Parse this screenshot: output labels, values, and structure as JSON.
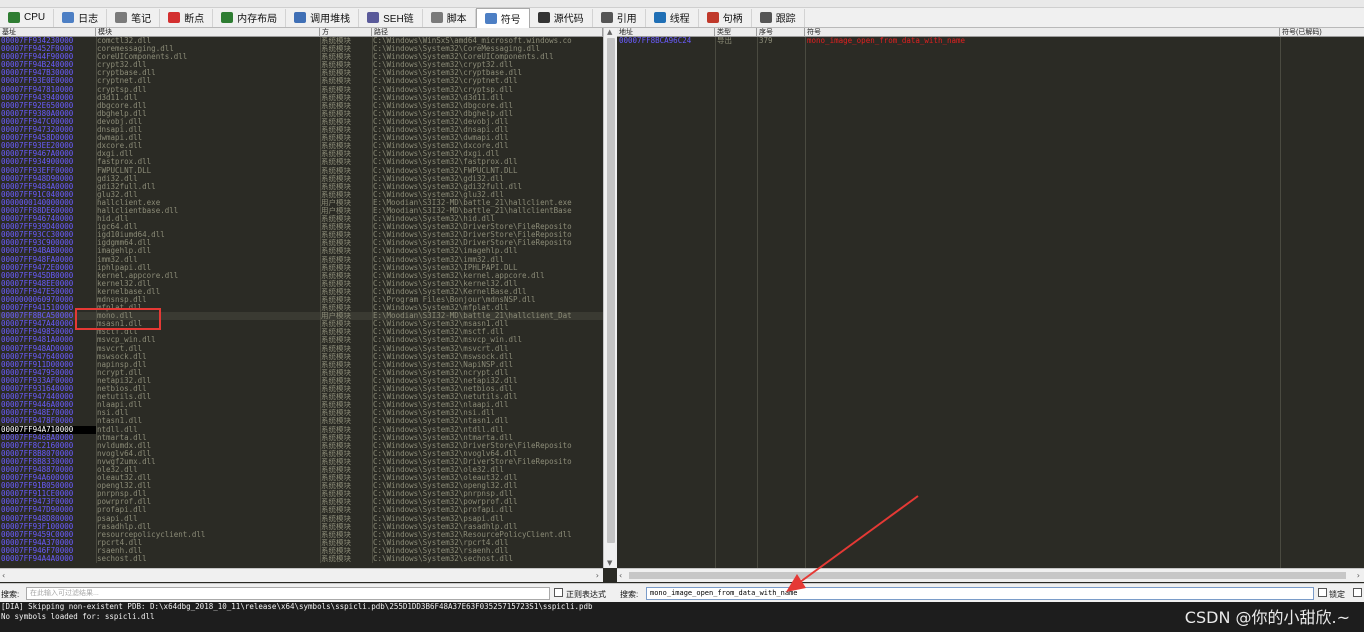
{
  "tabs": [
    {
      "label": "CPU",
      "icon": "cpu-icon",
      "color": "#2f7d32"
    },
    {
      "label": "日志",
      "icon": "log-icon",
      "color": "#4d7fc4"
    },
    {
      "label": "笔记",
      "icon": "notes-icon",
      "color": "#7a7a7a"
    },
    {
      "label": "断点",
      "icon": "breakpoint-icon",
      "color": "#d32f2f"
    },
    {
      "label": "内存布局",
      "icon": "memory-map-icon",
      "color": "#2e7d32"
    },
    {
      "label": "调用堆栈",
      "icon": "call-stack-icon",
      "color": "#3f6fb5"
    },
    {
      "label": "SEH链",
      "icon": "seh-chain-icon",
      "color": "#5a5a9a"
    },
    {
      "label": "脚本",
      "icon": "script-icon",
      "color": "#7a7a7a"
    },
    {
      "label": "符号",
      "icon": "symbols-icon",
      "color": "#4d7fc4"
    },
    {
      "label": "源代码",
      "icon": "source-icon",
      "color": "#333333"
    },
    {
      "label": "引用",
      "icon": "references-icon",
      "color": "#555555"
    },
    {
      "label": "线程",
      "icon": "threads-icon",
      "color": "#1f6fb5"
    },
    {
      "label": "句柄",
      "icon": "handles-icon",
      "color": "#c0392b"
    },
    {
      "label": "跟踪",
      "icon": "trace-icon",
      "color": "#555555"
    }
  ],
  "active_tab": 8,
  "left": {
    "headers": [
      "基址",
      "模块",
      "方",
      "路径"
    ],
    "rows": [
      [
        "00007FF934230000",
        "comctl32.dll",
        "系统模块",
        "C:\\Windows\\WinSxS\\amd64_microsoft.windows.co"
      ],
      [
        "00007FF9452F0000",
        "coremessaging.dll",
        "系统模块",
        "C:\\Windows\\System32\\CoreMessaging.dll"
      ],
      [
        "00007FF944F90000",
        "CoreUIComponents.dll",
        "系统模块",
        "C:\\Windows\\System32\\CoreUIComponents.dll"
      ],
      [
        "00007FF94B240000",
        "crypt32.dll",
        "系统模块",
        "C:\\Windows\\System32\\crypt32.dll"
      ],
      [
        "00007FF947B30000",
        "cryptbase.dll",
        "系统模块",
        "C:\\Windows\\System32\\cryptbase.dll"
      ],
      [
        "00007FF93E0E0000",
        "cryptnet.dll",
        "系统模块",
        "C:\\Windows\\System32\\cryptnet.dll"
      ],
      [
        "00007FF947810000",
        "cryptsp.dll",
        "系统模块",
        "C:\\Windows\\System32\\cryptsp.dll"
      ],
      [
        "00007FF943940000",
        "d3d11.dll",
        "系统模块",
        "C:\\Windows\\System32\\d3d11.dll"
      ],
      [
        "00007FF92E650000",
        "dbgcore.dll",
        "系统模块",
        "C:\\Windows\\System32\\dbgcore.dll"
      ],
      [
        "00007FF9380A0000",
        "dbghelp.dll",
        "系统模块",
        "C:\\Windows\\System32\\dbghelp.dll"
      ],
      [
        "00007FF947C00000",
        "devobj.dll",
        "系统模块",
        "C:\\Windows\\System32\\devobj.dll"
      ],
      [
        "00007FF947320000",
        "dnsapi.dll",
        "系统模块",
        "C:\\Windows\\System32\\dnsapi.dll"
      ],
      [
        "00007FF9458D0000",
        "dwmapi.dll",
        "系统模块",
        "C:\\Windows\\System32\\dwmapi.dll"
      ],
      [
        "00007FF93EE20000",
        "dxcore.dll",
        "系统模块",
        "C:\\Windows\\System32\\dxcore.dll"
      ],
      [
        "00007FF9467A0000",
        "dxgi.dll",
        "系统模块",
        "C:\\Windows\\System32\\dxgi.dll"
      ],
      [
        "00007FF934900000",
        "fastprox.dll",
        "系统模块",
        "C:\\Windows\\System32\\fastprox.dll"
      ],
      [
        "00007FF93EFF0000",
        "FWPUCLNT.DLL",
        "系统模块",
        "C:\\Windows\\System32\\FWPUCLNT.DLL"
      ],
      [
        "00007FF948D90000",
        "gdi32.dll",
        "系统模块",
        "C:\\Windows\\System32\\gdi32.dll"
      ],
      [
        "00007FF9484A0000",
        "gdi32full.dll",
        "系统模块",
        "C:\\Windows\\System32\\gdi32full.dll"
      ],
      [
        "00007FF91C040000",
        "glu32.dll",
        "系统模块",
        "C:\\Windows\\System32\\glu32.dll"
      ],
      [
        "0000000140000000",
        "hallclient.exe",
        "用户模块",
        "E:\\Moodian\\S3I32-MD\\battle_21\\hallclient.exe"
      ],
      [
        "00007FF88DE60000",
        "hallclientbase.dll",
        "用户模块",
        "E:\\Moodian\\S3I32-MD\\battle_21\\hallclientBase"
      ],
      [
        "00007FF946740000",
        "hid.dll",
        "系统模块",
        "C:\\Windows\\System32\\hid.dll"
      ],
      [
        "00007FF939D40000",
        "igc64.dll",
        "系统模块",
        "C:\\Windows\\System32\\DriverStore\\FileReposito"
      ],
      [
        "00007FF93CC30000",
        "igd10iumd64.dll",
        "系统模块",
        "C:\\Windows\\System32\\DriverStore\\FileReposito"
      ],
      [
        "00007FF93C900000",
        "igdgmm64.dll",
        "系统模块",
        "C:\\Windows\\System32\\DriverStore\\FileReposito"
      ],
      [
        "00007FF94BAB0000",
        "imagehlp.dll",
        "系统模块",
        "C:\\Windows\\System32\\imagehlp.dll"
      ],
      [
        "00007FF948FA0000",
        "imm32.dll",
        "系统模块",
        "C:\\Windows\\System32\\imm32.dll"
      ],
      [
        "00007FF9472E0000",
        "iphlpapi.dll",
        "系统模块",
        "C:\\Windows\\System32\\IPHLPAPI.DLL"
      ],
      [
        "00007FF945DB0000",
        "kernel.appcore.dll",
        "系统模块",
        "C:\\Windows\\System32\\kernel.appcore.dll"
      ],
      [
        "00007FF948EE0000",
        "kernel32.dll",
        "系统模块",
        "C:\\Windows\\System32\\kernel32.dll"
      ],
      [
        "00007FF947E50000",
        "kernelbase.dll",
        "系统模块",
        "C:\\Windows\\System32\\KernelBase.dll"
      ],
      [
        "0000000060970000",
        "mdnsnsp.dll",
        "系统模块",
        "C:\\Program Files\\Bonjour\\mdnsNSP.dll"
      ],
      [
        "00007FF941510000",
        "mfplat.dll",
        "系统模块",
        "C:\\Windows\\System32\\mfplat.dll"
      ],
      [
        "00007FF8BCA50000",
        "mono.dll",
        "用户模块",
        "E:\\Moodian\\S3I32-MD\\battle_21\\hallclient_Dat"
      ],
      [
        "00007FF947A40000",
        "msasn1.dll",
        "系统模块",
        "C:\\Windows\\System32\\msasn1.dll"
      ],
      [
        "00007FF949850000",
        "msctf.dll",
        "系统模块",
        "C:\\Windows\\System32\\msctf.dll"
      ],
      [
        "00007FF9481A0000",
        "msvcp_win.dll",
        "系统模块",
        "C:\\Windows\\System32\\msvcp_win.dll"
      ],
      [
        "00007FF948AD0000",
        "msvcrt.dll",
        "系统模块",
        "C:\\Windows\\System32\\msvcrt.dll"
      ],
      [
        "00007FF947640000",
        "mswsock.dll",
        "系统模块",
        "C:\\Windows\\System32\\mswsock.dll"
      ],
      [
        "00007FF911D00000",
        "napinsp.dll",
        "系统模块",
        "C:\\Windows\\System32\\NapiNSP.dll"
      ],
      [
        "00007FF947950000",
        "ncrypt.dll",
        "系统模块",
        "C:\\Windows\\System32\\ncrypt.dll"
      ],
      [
        "00007FF933AF0000",
        "netapi32.dll",
        "系统模块",
        "C:\\Windows\\System32\\netapi32.dll"
      ],
      [
        "00007FF931640000",
        "netbios.dll",
        "系统模块",
        "C:\\Windows\\System32\\netbios.dll"
      ],
      [
        "00007FF947440000",
        "netutils.dll",
        "系统模块",
        "C:\\Windows\\System32\\netutils.dll"
      ],
      [
        "00007FF9446A0000",
        "nlaapi.dll",
        "系统模块",
        "C:\\Windows\\System32\\nlaapi.dll"
      ],
      [
        "00007FF948E70000",
        "nsi.dll",
        "系统模块",
        "C:\\Windows\\System32\\nsi.dll"
      ],
      [
        "00007FF9478F0000",
        "ntasn1.dll",
        "系统模块",
        "C:\\Windows\\System32\\ntasn1.dll"
      ],
      [
        "00007FF94A710000",
        "ntdll.dll",
        "系统模块",
        "C:\\Windows\\System32\\ntdll.dll"
      ],
      [
        "00007FF946BA0000",
        "ntmarta.dll",
        "系统模块",
        "C:\\Windows\\System32\\ntmarta.dll"
      ],
      [
        "00007FF8C2160000",
        "nvldumdx.dll",
        "系统模块",
        "C:\\Windows\\System32\\DriverStore\\FileReposito"
      ],
      [
        "00007FF8B8070000",
        "nvoglv64.dll",
        "系统模块",
        "C:\\Windows\\System32\\nvoglv64.dll"
      ],
      [
        "00007FF8B8330000",
        "nvwgf2umx.dll",
        "系统模块",
        "C:\\Windows\\System32\\DriverStore\\FileReposito"
      ],
      [
        "00007FF948870000",
        "ole32.dll",
        "系统模块",
        "C:\\Windows\\System32\\ole32.dll"
      ],
      [
        "00007FF94A600000",
        "oleaut32.dll",
        "系统模块",
        "C:\\Windows\\System32\\oleaut32.dll"
      ],
      [
        "00007FF91B050000",
        "opengl32.dll",
        "系统模块",
        "C:\\Windows\\System32\\opengl32.dll"
      ],
      [
        "00007FF911CE0000",
        "pnrpnsp.dll",
        "系统模块",
        "C:\\Windows\\System32\\pnrpnsp.dll"
      ],
      [
        "00007FF9473F0000",
        "powrprof.dll",
        "系统模块",
        "C:\\Windows\\System32\\powrprof.dll"
      ],
      [
        "00007FF947D90000",
        "profapi.dll",
        "系统模块",
        "C:\\Windows\\System32\\profapi.dll"
      ],
      [
        "00007FF948D80000",
        "psapi.dll",
        "系统模块",
        "C:\\Windows\\System32\\psapi.dll"
      ],
      [
        "00007FF93F100000",
        "rasadhlp.dll",
        "系统模块",
        "C:\\Windows\\System32\\rasadhlp.dll"
      ],
      [
        "00007FF9459C0000",
        "resourcepolicyclient.dll",
        "系统模块",
        "C:\\Windows\\System32\\ResourcePolicyClient.dll"
      ],
      [
        "00007FF94A370000",
        "rpcrt4.dll",
        "系统模块",
        "C:\\Windows\\System32\\rpcrt4.dll"
      ],
      [
        "00007FF946F70000",
        "rsaenh.dll",
        "系统模块",
        "C:\\Windows\\System32\\rsaenh.dll"
      ],
      [
        "00007FF94A4A0000",
        "sechost.dll",
        "系统模块",
        "C:\\Windows\\System32\\sechost.dll"
      ]
    ],
    "selected_row": 34,
    "highlight_row": 48
  },
  "right": {
    "headers": [
      "地址",
      "类型",
      "序号",
      "符号",
      "符号(已解码)"
    ],
    "rows": [
      [
        "00007FF8BCA96C24",
        "导出",
        "379",
        "mono_image_open_from_data_with_name",
        ""
      ]
    ]
  },
  "search_left": {
    "label": "搜索:",
    "placeholder": "在此输入可过滤结果...",
    "regex_label": "正则表达式"
  },
  "search_right": {
    "label": "搜索:",
    "value": "mono_image_open_from_data_with_name",
    "lock_label": "锁定"
  },
  "log_lines": [
    "[DIA] Skipping non-existent PDB: D:\\x64dbg_2018_10_11\\release\\x64\\symbols\\sspicli.pdb\\255D1DD3B6F48A37E63F03525715723S1\\sspicli.pdb",
    "No symbols loaded for: sspicli.dll"
  ],
  "watermark": "CSDN @你的小甜欣.~",
  "colors": {
    "address": "#6a5cff",
    "symbol": "#e02020",
    "annotation": "#e53935"
  }
}
